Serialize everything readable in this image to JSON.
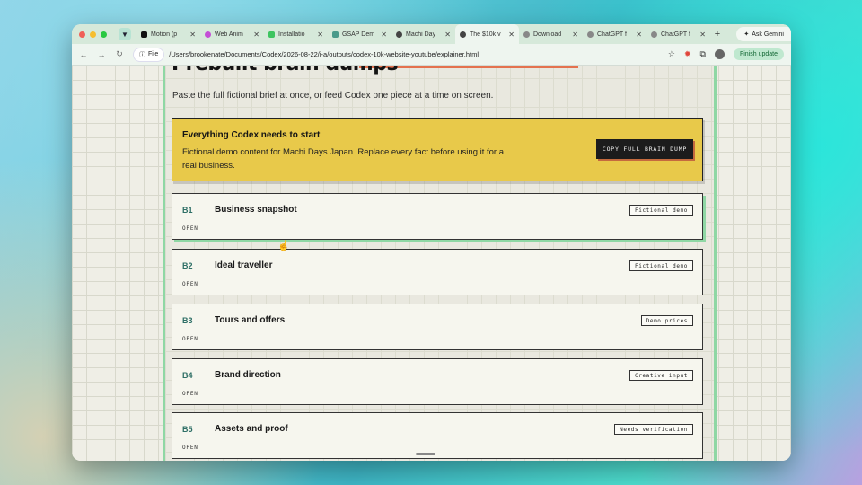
{
  "browser": {
    "tabs": [
      {
        "label": "Motion (p",
        "favicon": "motion-icon",
        "color": "#111111"
      },
      {
        "label": "Web Anim",
        "favicon": "animation-icon",
        "color": "#c44fd6"
      },
      {
        "label": "Installatio",
        "favicon": "gsap-green-icon",
        "color": "#3ec460"
      },
      {
        "label": "GSAP Dem",
        "favicon": "gsap-grid-icon",
        "color": "#4a9a8a"
      },
      {
        "label": "Machi Day",
        "favicon": "globe-icon",
        "color": "#444444"
      },
      {
        "label": "The $10k v",
        "favicon": "globe-icon",
        "color": "#444444",
        "active": true
      },
      {
        "label": "Download",
        "favicon": "chrome-icon",
        "color": "#888888"
      },
      {
        "label": "ChatGPT f",
        "favicon": "chrome-icon",
        "color": "#888888"
      },
      {
        "label": "ChatGPT f",
        "favicon": "chrome-icon",
        "color": "#888888"
      }
    ],
    "ask_gemini_label": "Ask Gemini",
    "file_chip_label": "File",
    "url": "/Users/brookenate/Documents/Codex/2026-08-22/i-a/outputs/codex-10k-website-youtube/explainer.html",
    "finish_update_label": "Finish update"
  },
  "page": {
    "heading": "Prebuilt brain dumps",
    "subtitle": "Paste the full fictional brief at once, or feed Codex one piece at a time on screen.",
    "start_card": {
      "title": "Everything Codex needs to start",
      "body": "Fictional demo content for Machi Days Japan. Replace every fact before using it for a real business.",
      "button_label": "COPY FULL BRAIN DUMP"
    },
    "sections": [
      {
        "code": "B1",
        "name": "Business snapshot",
        "badge": "Fictional demo",
        "status": "OPEN"
      },
      {
        "code": "B2",
        "name": "Ideal traveller",
        "badge": "Fictional demo",
        "status": "OPEN"
      },
      {
        "code": "B3",
        "name": "Tours and offers",
        "badge": "Demo prices",
        "status": "OPEN"
      },
      {
        "code": "B4",
        "name": "Brand direction",
        "badge": "Creative input",
        "status": "OPEN"
      },
      {
        "code": "B5",
        "name": "Assets and proof",
        "badge": "Needs verification",
        "status": "OPEN"
      }
    ]
  },
  "colors": {
    "accent_yellow": "#e8c94a",
    "accent_green": "#8fd7a4",
    "accent_orange": "#e4724f",
    "code_teal": "#2e6f66"
  }
}
